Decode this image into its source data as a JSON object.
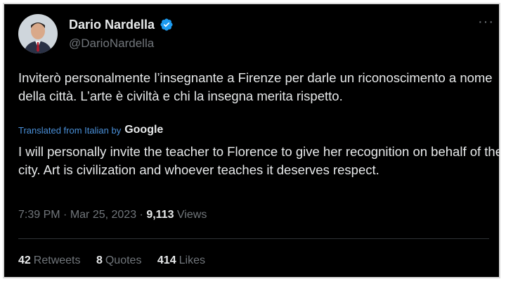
{
  "author": {
    "name": "Dario Nardella",
    "handle": "@DarioNardella"
  },
  "more_icon": "···",
  "tweet": {
    "text": "Inviterò personalmente l’insegnante a Firenze per darle un riconoscimento a nome della città. L’arte è civiltà e chi la insegna merita rispetto.",
    "translated_label": "Translated from Italian by",
    "translator": "Google",
    "translation": "I will personally invite the teacher to Florence to give her recognition on behalf of the city. Art is civilization and whoever teaches it deserves respect."
  },
  "meta": {
    "time": "7:39 PM",
    "sep": " · ",
    "date": "Mar 25, 2023",
    "views_count": "9,113",
    "views_label": "Views"
  },
  "stats": {
    "retweets_count": "42",
    "retweets_label": "Retweets",
    "quotes_count": "8",
    "quotes_label": "Quotes",
    "likes_count": "414",
    "likes_label": "Likes"
  },
  "colors": {
    "background": "#000000",
    "text": "#e7e9ea",
    "muted": "#71767b",
    "link": "#4a90d9",
    "verified": "#1d9bf0"
  }
}
